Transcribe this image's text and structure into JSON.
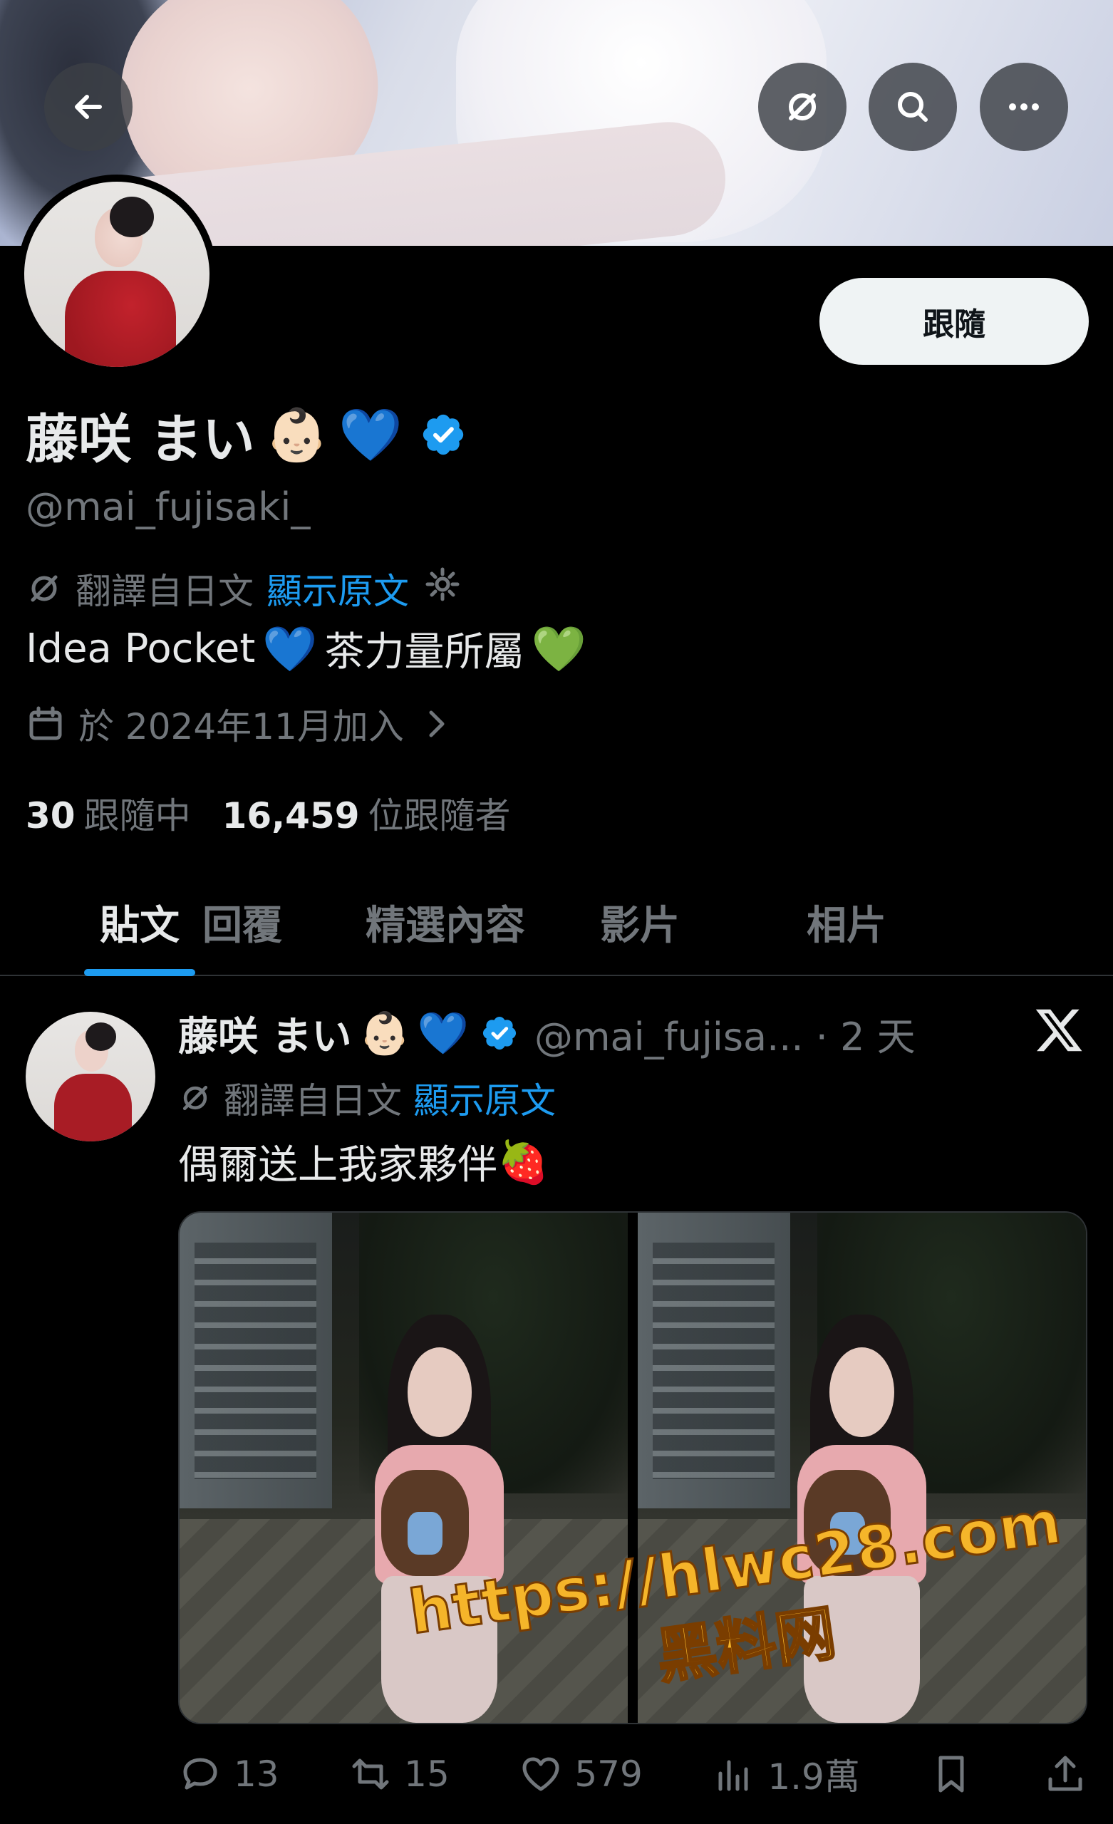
{
  "header": {
    "back_icon": "arrow-left-icon",
    "translate_icon": "translate-off-icon",
    "search_icon": "search-icon",
    "more_icon": "more-horizontal-icon"
  },
  "profile": {
    "display_name": "藤咲 まい",
    "name_emojis": [
      "👶🏻",
      "💙"
    ],
    "handle": "@mai_fujisaki_",
    "follow_label": "跟隨",
    "translated_from": "翻譯自日文",
    "show_original": "顯示原文",
    "bio_prefix": "Idea Pocket",
    "bio_heart1": "💙",
    "bio_middle": " 茶力量所屬",
    "bio_heart2": "💚",
    "joined": "於 2024年11月加入",
    "following_count": "30",
    "following_label": "跟隨中",
    "followers_count": "16,459",
    "followers_label": "位跟隨者"
  },
  "tabs": [
    {
      "label": "貼文",
      "active": true
    },
    {
      "label": "回覆",
      "active": false
    },
    {
      "label": "精選內容",
      "active": false
    },
    {
      "label": "影片",
      "active": false
    },
    {
      "label": "相片",
      "active": false
    }
  ],
  "post": {
    "author_name": "藤咲 まい",
    "author_emojis": [
      "👶🏻",
      "💙"
    ],
    "meta": "@mai_fujisa... · 2 天",
    "translated_from": "翻譯自日文",
    "show_original": "顯示原文",
    "text": "偶爾送上我家夥伴",
    "text_emoji": "🍓",
    "watermark_url": "https://hlwc28.com",
    "watermark_cn": "黑料网",
    "actions": {
      "replies": "13",
      "reposts": "15",
      "likes": "579",
      "views": "1.9萬"
    }
  },
  "colors": {
    "accent": "#1d9bf0",
    "muted": "#71767b",
    "text": "#e7e9ea",
    "background": "#000000"
  }
}
